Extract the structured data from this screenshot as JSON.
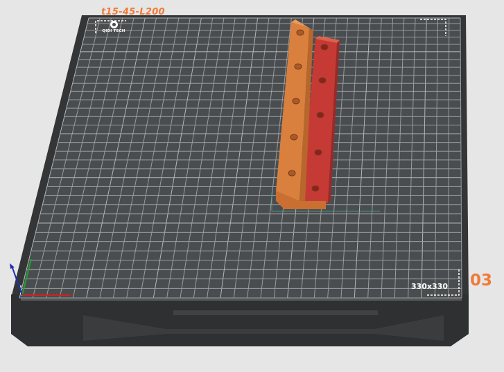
{
  "scene": {
    "plate_name": "t15-45-L200",
    "plate_number": "03",
    "bed_size_label": "330x330",
    "logo_text": "QIDI TECH"
  },
  "colors": {
    "background": "#e6e6e6",
    "bed_frame": "#3a3c3d",
    "bed_surface": "#4a4d4f",
    "grid_line": "#9a9d9f",
    "model_orange": "#d9803e",
    "model_red": "#c63a36",
    "label_accent": "#f07a3a",
    "axis_x": "#d02020",
    "axis_y": "#20a030",
    "axis_z": "#2030b0"
  },
  "icons": {
    "logo": "qidi-tech-logo",
    "axes": "xyz-axis-gizmo"
  }
}
